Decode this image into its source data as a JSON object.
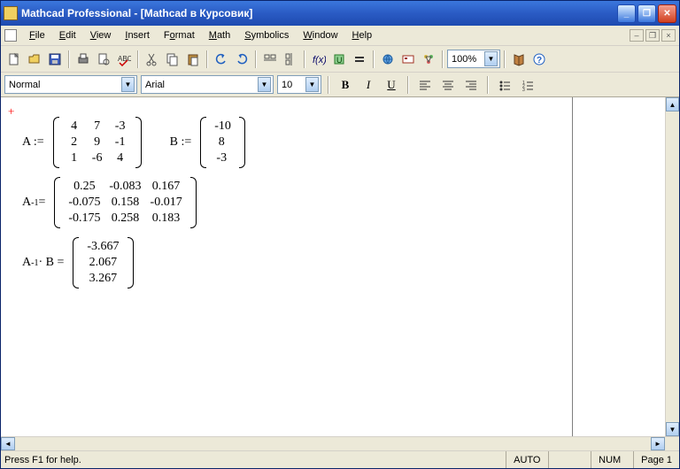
{
  "title": "Mathcad Professional - [Mathcad в Курсовик]",
  "menus": [
    "File",
    "Edit",
    "View",
    "Insert",
    "Format",
    "Math",
    "Symbolics",
    "Window",
    "Help"
  ],
  "toolbar2": {
    "style_select": "Normal",
    "font_select": "Arial",
    "size_select": "10"
  },
  "zoom": "100%",
  "status": {
    "help": "Press F1 for help.",
    "auto": "AUTO",
    "num": "NUM",
    "page": "Page 1"
  },
  "math": {
    "A_assign": "A :=",
    "A": [
      [
        "4",
        "7",
        "-3"
      ],
      [
        "2",
        "9",
        "-1"
      ],
      [
        "1",
        "-6",
        "4"
      ]
    ],
    "B_assign": "B :=",
    "B": [
      [
        "-10"
      ],
      [
        "8"
      ],
      [
        "-3"
      ]
    ],
    "Ainv_label_base": "A",
    "Ainv_label_sup": "-1",
    "eq": " = ",
    "Ainv": [
      [
        "0.25",
        "-0.083",
        "0.167"
      ],
      [
        "-0.075",
        "0.158",
        "-0.017"
      ],
      [
        "-0.175",
        "0.258",
        "0.183"
      ]
    ],
    "AinvB_label": " · B = ",
    "AinvB": [
      [
        "-3.667"
      ],
      [
        "2.067"
      ],
      [
        "3.267"
      ]
    ]
  },
  "titlebtns": {
    "min": "_",
    "max": "❐",
    "close": "✕"
  },
  "mdi": {
    "min": "–",
    "restore": "❐",
    "close": "×"
  }
}
